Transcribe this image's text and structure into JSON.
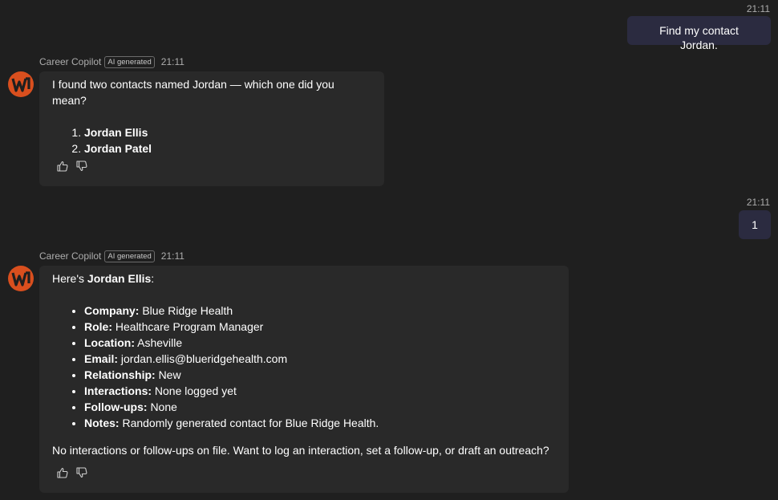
{
  "messages": {
    "user1": {
      "time": "21:11",
      "text": "Find my contact Jordan."
    },
    "bot1": {
      "sender": "Career Copilot",
      "badge": "AI generated",
      "time": "21:11",
      "intro": "I found two contacts named Jordan — which one did you mean?",
      "options": [
        "Jordan Ellis",
        "Jordan Patel"
      ]
    },
    "user2": {
      "time": "21:11",
      "text": "1"
    },
    "bot2": {
      "sender": "Career Copilot",
      "badge": "AI generated",
      "time": "21:11",
      "intro_prefix": "Here's ",
      "intro_name": "Jordan Ellis",
      "intro_suffix": ":",
      "details": [
        {
          "label": "Company:",
          "value": "Blue Ridge Health"
        },
        {
          "label": "Role:",
          "value": "Healthcare Program Manager"
        },
        {
          "label": "Location:",
          "value": "Asheville"
        },
        {
          "label": "Email:",
          "value": "jordan.ellis@blueridgehealth.com"
        },
        {
          "label": "Relationship:",
          "value": "New"
        },
        {
          "label": "Interactions:",
          "value": "None logged yet"
        },
        {
          "label": "Follow-ups:",
          "value": "None"
        },
        {
          "label": "Notes:",
          "value": "Randomly generated contact for Blue Ridge Health."
        }
      ],
      "closing": "No interactions or follow-ups on file. Want to log an interaction, set a follow-up, or draft an outreach?"
    }
  },
  "icons": {
    "avatar": "career-copilot-logo",
    "like": "thumbs-up-icon",
    "dislike": "thumbs-down-icon"
  },
  "colors": {
    "accent_orange": "#d94f1e",
    "user_bubble": "#2b2b40",
    "bot_bubble": "#292929"
  }
}
